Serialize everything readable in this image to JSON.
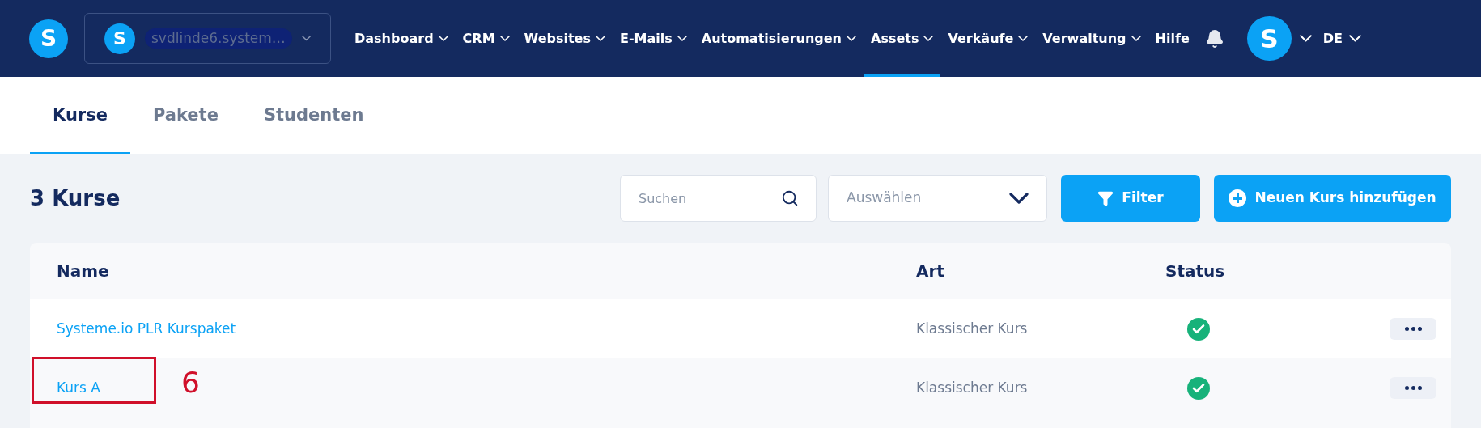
{
  "header": {
    "logo": "S",
    "account": {
      "avatar": "S",
      "name": "svdlinde6.system…"
    },
    "nav": [
      {
        "label": "Dashboard",
        "dropdown": true,
        "selected": false
      },
      {
        "label": "CRM",
        "dropdown": true,
        "selected": false
      },
      {
        "label": "Websites",
        "dropdown": true,
        "selected": false
      },
      {
        "label": "E-Mails",
        "dropdown": true,
        "selected": false
      },
      {
        "label": "Automatisierungen",
        "dropdown": true,
        "selected": false
      },
      {
        "label": "Assets",
        "dropdown": true,
        "selected": true
      },
      {
        "label": "Verkäufe",
        "dropdown": true,
        "selected": false
      },
      {
        "label": "Verwaltung",
        "dropdown": true,
        "selected": false
      },
      {
        "label": "Hilfe",
        "dropdown": false,
        "selected": false
      }
    ],
    "user_avatar": "S",
    "language": "DE"
  },
  "tabs": [
    {
      "label": "Kurse",
      "selected": true
    },
    {
      "label": "Pakete",
      "selected": false
    },
    {
      "label": "Studenten",
      "selected": false
    }
  ],
  "page_title": "3 Kurse",
  "search": {
    "placeholder": "Suchen"
  },
  "select": {
    "placeholder": "Auswählen"
  },
  "buttons": {
    "filter": "Filter",
    "add": "Neuen Kurs hinzufügen"
  },
  "table": {
    "columns": [
      "Name",
      "Art",
      "Status"
    ],
    "rows": [
      {
        "name": "Systeme.io PLR Kurspaket",
        "type": "Klassischer Kurs",
        "active": true,
        "annotation": null
      },
      {
        "name": "Kurs A",
        "type": "Klassischer Kurs",
        "active": true,
        "annotation": "6"
      }
    ]
  }
}
